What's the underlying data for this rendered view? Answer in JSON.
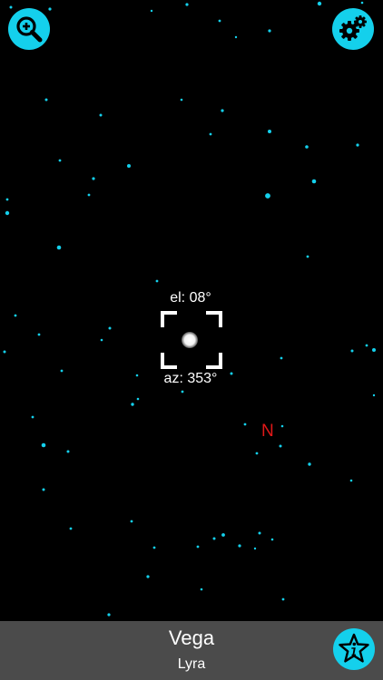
{
  "colors": {
    "background": "#000000",
    "star": "#14d0ec",
    "button": "#14d0ec",
    "north_marker": "#e01818",
    "bottom_bar": "#4b4b4b",
    "reticle": "#ffffff"
  },
  "toolbar": {
    "zoom_icon": "magnifier-plus-icon",
    "settings_icon": "gears-icon",
    "info_icon": "star-info-icon"
  },
  "pointing": {
    "elevation": "el: 08°",
    "azimuth": "az: 353°"
  },
  "compass": {
    "north": "N"
  },
  "selected": {
    "star_name": "Vega",
    "constellation": "Lyra"
  }
}
